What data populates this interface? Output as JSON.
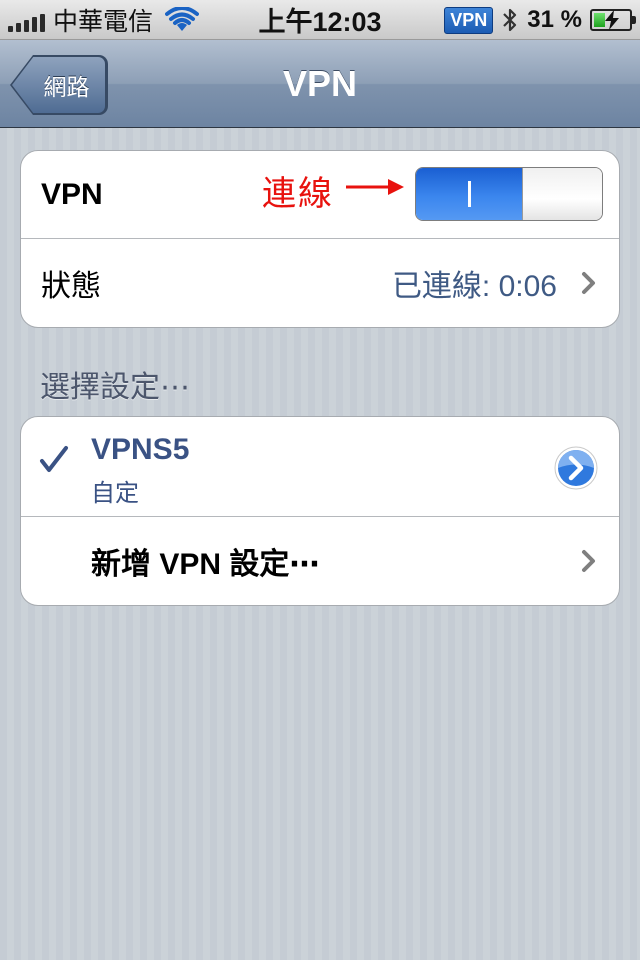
{
  "status_bar": {
    "carrier": "中華電信",
    "time": "上午12:03",
    "vpn_badge": "VPN",
    "battery": "31 %",
    "battery_level": 0.31,
    "icons": [
      "signal-icon",
      "wifi-icon",
      "bluetooth-icon",
      "battery-icon"
    ]
  },
  "nav": {
    "back_label": "網路",
    "title": "VPN"
  },
  "vpn_group": {
    "vpn_label": "VPN",
    "toggle_state": "on",
    "status_label": "狀態",
    "status_value": "已連線: 0:06"
  },
  "annotation": {
    "text": "連線",
    "color": "#e8120e"
  },
  "section": {
    "header": "選擇設定⋯"
  },
  "configs": {
    "items": [
      {
        "name": "VPNS5",
        "type": "自定",
        "selected": true
      }
    ],
    "add_label": "新增 VPN 設定⋯"
  },
  "colors": {
    "accent": "#3b86ee",
    "nav": "#6d84a2",
    "value_text": "#3f5a84"
  }
}
